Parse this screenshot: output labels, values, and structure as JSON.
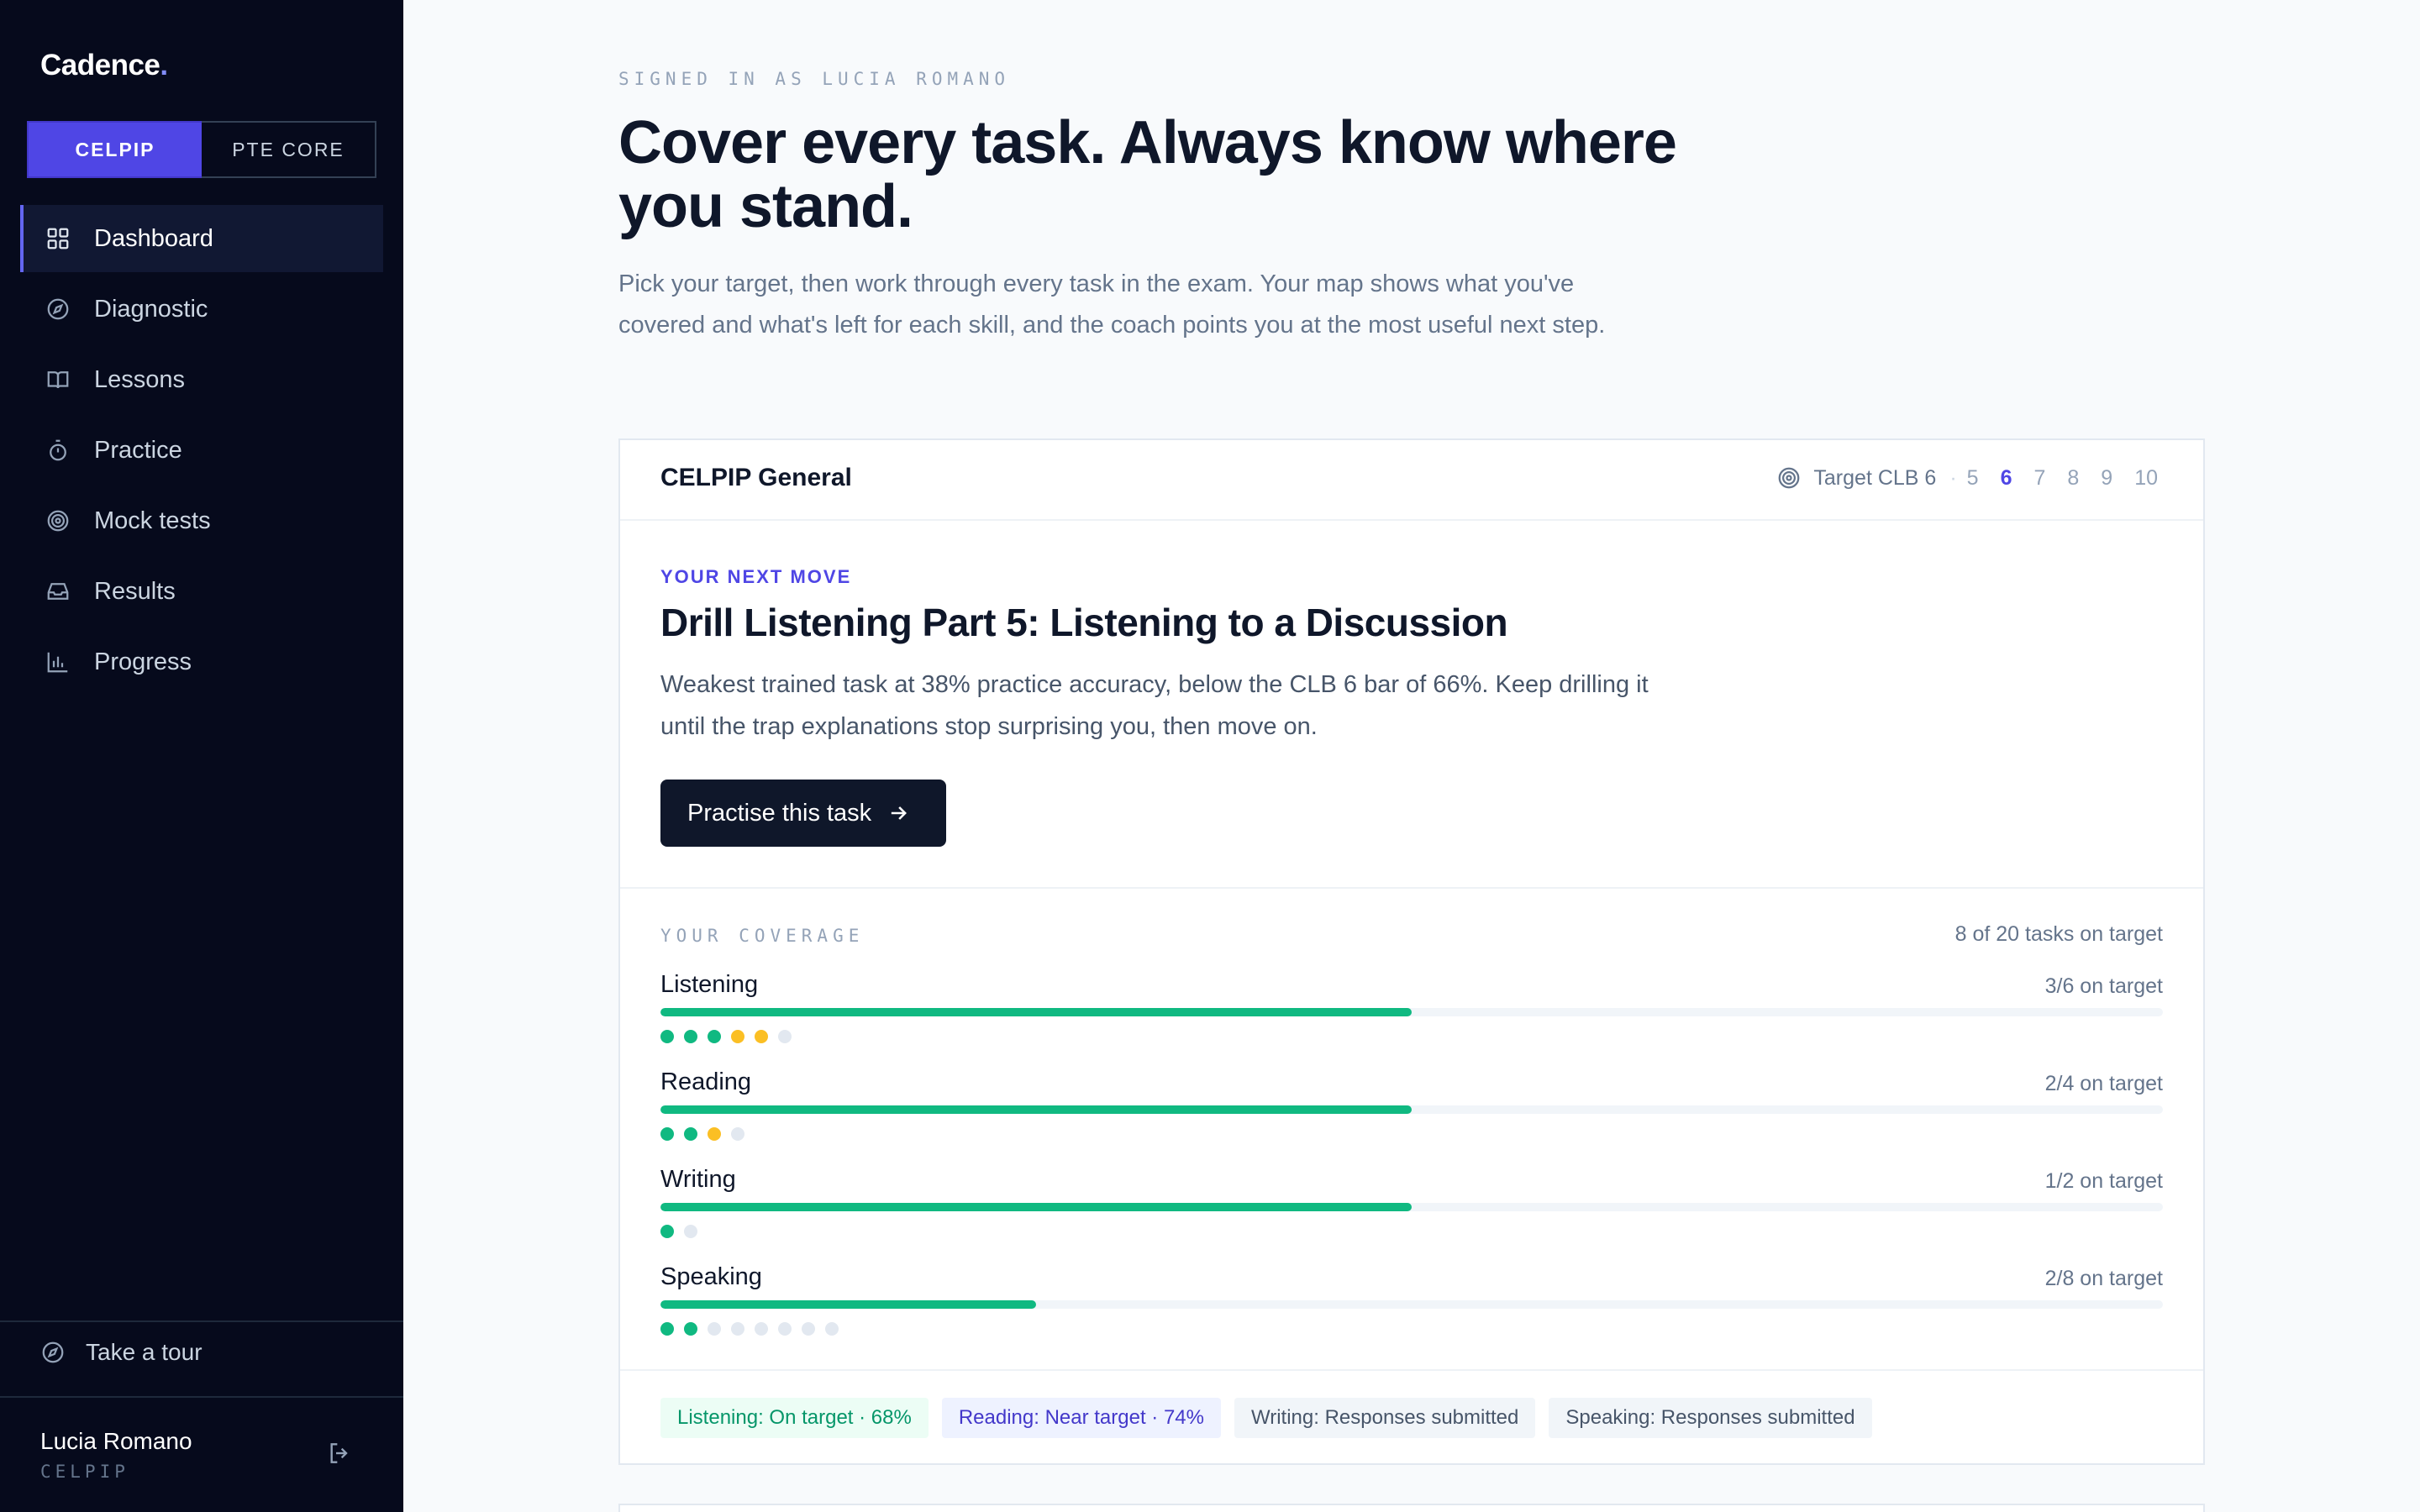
{
  "app": {
    "logo": "Cadence",
    "logo_dot": "."
  },
  "exam_toggle": {
    "options": [
      "CELPIP",
      "PTE CORE"
    ],
    "selected": "CELPIP"
  },
  "nav": {
    "items": [
      {
        "label": "Dashboard",
        "icon": "grid-icon",
        "active": true
      },
      {
        "label": "Diagnostic",
        "icon": "compass-icon"
      },
      {
        "label": "Lessons",
        "icon": "book-icon"
      },
      {
        "label": "Practice",
        "icon": "stopwatch-icon"
      },
      {
        "label": "Mock tests",
        "icon": "target-icon"
      },
      {
        "label": "Results",
        "icon": "inbox-icon"
      },
      {
        "label": "Progress",
        "icon": "bar-chart-icon"
      }
    ]
  },
  "footer": {
    "tour_label": "Take a tour",
    "user_name": "Lucia Romano",
    "user_exam": "CELPIP"
  },
  "header": {
    "signed_in": "SIGNED IN AS LUCIA ROMANO",
    "headline": "Cover every task. Always know where you stand.",
    "intro": "Pick your target, then work through every task in the exam. Your map shows what you've covered and what's left for each skill, and the coach points you at the most useful next step."
  },
  "card": {
    "title": "CELPIP General",
    "target_label": "Target CLB 6",
    "target_separator": "·",
    "clb_options": [
      "5",
      "6",
      "7",
      "8",
      "9",
      "10"
    ],
    "clb_selected": "6",
    "next_move": {
      "label": "YOUR NEXT MOVE",
      "title": "Drill Listening Part 5: Listening to a Discussion",
      "description": "Weakest trained task at 38% practice accuracy, below the CLB 6 bar of 66%. Keep drilling it until the trap explanations stop surprising you, then move on.",
      "cta_label": "Practise this task"
    },
    "coverage": {
      "label": "YOUR COVERAGE",
      "total": "8 of 20 tasks on target",
      "skills": [
        {
          "name": "Listening",
          "stat": "3/6 on target",
          "progress": 0.5,
          "dots": [
            "green",
            "green",
            "green",
            "amber",
            "amber",
            "gray"
          ]
        },
        {
          "name": "Reading",
          "stat": "2/4 on target",
          "progress": 0.5,
          "dots": [
            "green",
            "green",
            "amber",
            "gray"
          ]
        },
        {
          "name": "Writing",
          "stat": "1/2 on target",
          "progress": 0.5,
          "dots": [
            "green",
            "gray"
          ]
        },
        {
          "name": "Speaking",
          "stat": "2/8 on target",
          "progress": 0.25,
          "dots": [
            "green",
            "green",
            "gray",
            "gray",
            "gray",
            "gray",
            "gray",
            "gray"
          ]
        }
      ]
    },
    "chips": [
      {
        "label": "Listening: On target · 68%",
        "tone": "green"
      },
      {
        "label": "Reading: Near target · 74%",
        "tone": "indigo"
      },
      {
        "label": "Writing: Responses submitted",
        "tone": "gray"
      },
      {
        "label": "Speaking: Responses submitted",
        "tone": "gray"
      }
    ]
  },
  "colors": {
    "sidebar_bg": "#060a1c",
    "accent": "#4f46e5",
    "on_target": "#10b981",
    "near_target": "#fbbf24",
    "pending": "#e2e8f0"
  }
}
